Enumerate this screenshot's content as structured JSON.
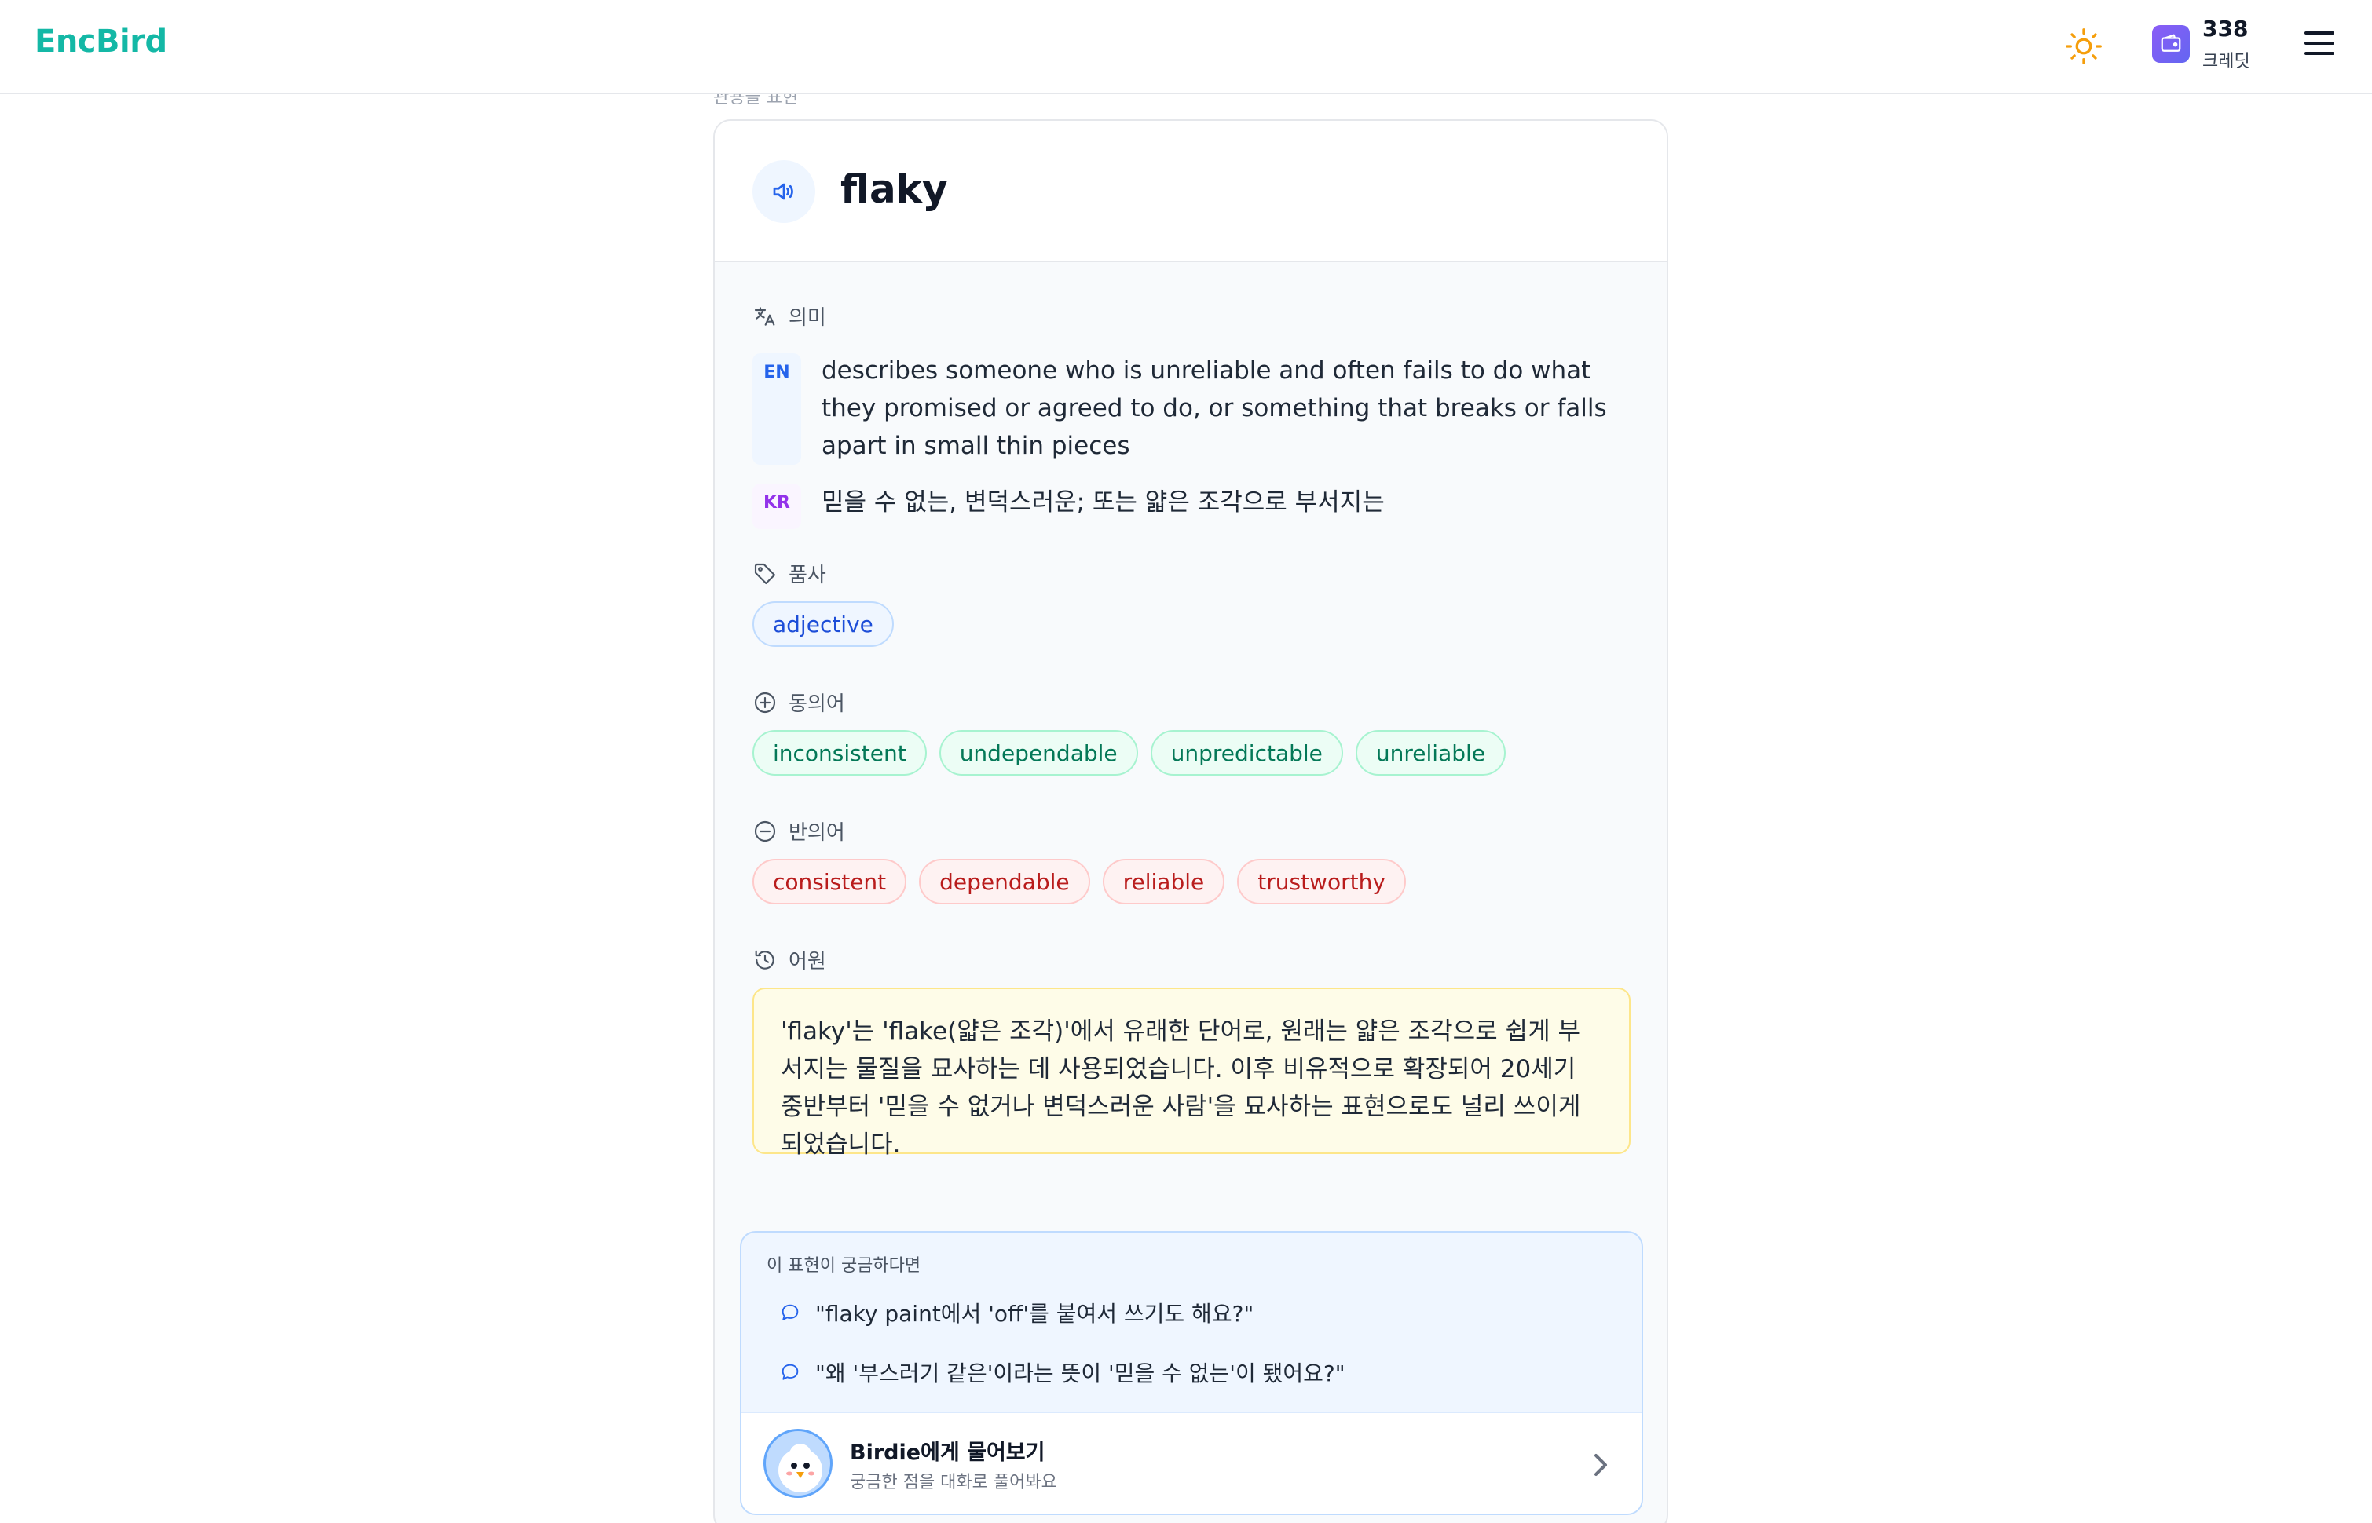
{
  "header": {
    "logo": "EncBird",
    "credits": "338",
    "credits_label": "크레딧",
    "icons": [
      "sun-icon",
      "wallet-icon",
      "menu-icon"
    ]
  },
  "scrolled_label": "관용을 표현",
  "word": "flaky",
  "meaning": {
    "label": "의미",
    "en_tag": "EN",
    "en": "describes someone who is unreliable and often fails to do what they promised or agreed to do, or something that breaks or falls apart in small thin pieces",
    "kr_tag": "KR",
    "kr": "믿을 수 없는, 변덕스러운; 또는 얇은 조각으로 부서지는"
  },
  "pos": {
    "label": "품사",
    "items": [
      "adjective"
    ]
  },
  "synonyms": {
    "label": "동의어",
    "items": [
      "inconsistent",
      "undependable",
      "unpredictable",
      "unreliable"
    ]
  },
  "antonyms": {
    "label": "반의어",
    "items": [
      "consistent",
      "dependable",
      "reliable",
      "trustworthy"
    ]
  },
  "etymology": {
    "label": "어원",
    "text": "'flaky'는 'flake(얇은 조각)'에서 유래한 단어로, 원래는 얇은 조각으로 쉽게 부서지는 물질을 묘사하는 데 사용되었습니다. 이후 비유적으로 확장되어 20세기 중반부터 '믿을 수 없거나 변덕스러운 사람'을 묘사하는 표현으로도 널리 쓰이게 되었습니다."
  },
  "ask": {
    "title": "이 표현이 궁금하다면",
    "questions": [
      "\"flaky paint에서 'off'를 붙여서 쓰기도 해요?\"",
      "\"왜 '부스러기 같은'이라는 뜻이 '믿을 수 없는'이 됐어요?\""
    ],
    "birdie_title": "Birdie에게 물어보기",
    "birdie_sub": "궁금한 점을 대화로 풀어봐요"
  },
  "colors": {
    "brand": "#14b8a6",
    "credit": "#8b5cf6",
    "sun": "#f59e0b"
  }
}
